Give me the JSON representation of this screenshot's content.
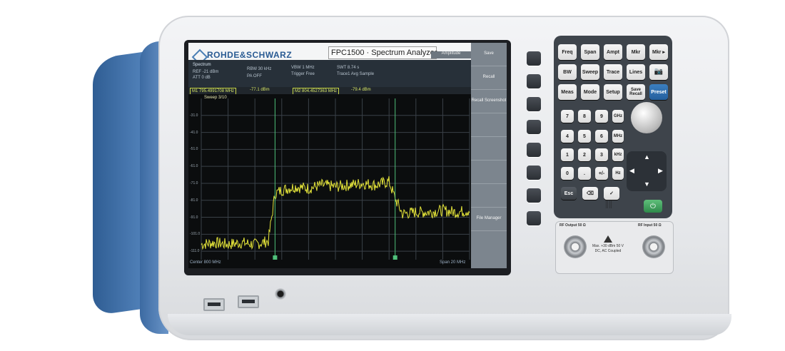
{
  "device": {
    "brand": "ROHDE&SCHWARZ",
    "model_title": "FPC1500 · Spectrum Analyzer"
  },
  "screen": {
    "mode_tab": "Spectrum",
    "menu_header": "Amplitude",
    "info": {
      "ref": "REF  -21 dBm",
      "att": "ATT  0 dB",
      "rbw": "RBW  30 kHz",
      "pa": "PA  OFF",
      "vbw": "VBW  1 MHz",
      "trigger": "Trigger  Free",
      "swt": "SWT  8.74 s",
      "trace1": "Trace1  Avg Sample"
    },
    "markers": [
      {
        "label": "M1",
        "freq": "795.4991708 MHz",
        "level": "-77.1 dBm"
      },
      {
        "label": "M2",
        "freq": "804.4527363 MHz",
        "level": "-79.4 dBm"
      }
    ],
    "sweep": "Sweep  3/10",
    "y_ticks": [
      "-31.0",
      "-41.0",
      "-51.0",
      "-61.0",
      "-71.0",
      "-81.0",
      "-91.0",
      "-101.0",
      "-111.0"
    ],
    "center": "Center  800 MHz",
    "span": "Span  20 MHz",
    "softkeys": [
      "Save",
      "Recall",
      "Recall Screenshot",
      "",
      "",
      "",
      "",
      "File Manager"
    ]
  },
  "keypad": {
    "row1": [
      "Freq",
      "Span",
      "Ampt",
      "Mkr",
      "Mkr ▸"
    ],
    "row2": [
      "BW",
      "Sweep",
      "Trace",
      "Lines",
      "📷"
    ],
    "row3": [
      "Meas",
      "Mode",
      "Setup",
      "Save Recall",
      "Preset"
    ],
    "digits": [
      "7",
      "8",
      "9",
      "4",
      "5",
      "6",
      "1",
      "2",
      "3",
      "0",
      ".",
      "+/-"
    ],
    "units": [
      "GHz",
      "MHz",
      "kHz",
      "Hz"
    ],
    "bottom": [
      "Esc",
      "⌫",
      "✓"
    ],
    "power_icon": "power-icon",
    "accent_preset": "#2a6aad",
    "accent_power": "#3fa25f"
  },
  "connectors": {
    "rf_output": "RF Output 50 Ω",
    "rf_input": "RF Input 50 Ω",
    "warning": "Max. +30 dBm 50 V DC, AC Coupled"
  },
  "chart_data": {
    "type": "line",
    "title": "",
    "xlabel": "Center 800 MHz",
    "ylabel": "",
    "x_unit": "MHz",
    "xlim": [
      790,
      810
    ],
    "ylim": [
      -116,
      -21
    ],
    "grid": true,
    "series": [
      {
        "x": [
          790,
          791,
          792,
          793,
          794,
          795,
          795.5,
          796,
          797,
          798,
          799,
          800,
          801,
          802,
          803,
          804,
          804.45,
          805,
          806,
          807,
          808,
          809,
          810
        ],
        "y": [
          -107,
          -106,
          -107,
          -106,
          -107,
          -105,
          -77,
          -75,
          -73,
          -74,
          -72,
          -73,
          -72,
          -71,
          -72,
          -70,
          -80,
          -89,
          -88,
          -88,
          -87,
          -88,
          -87
        ]
      }
    ],
    "markers": [
      {
        "name": "M1",
        "x": 795.4991708,
        "y": -77.1
      },
      {
        "name": "M2",
        "x": 804.4527363,
        "y": -79.4
      }
    ]
  }
}
